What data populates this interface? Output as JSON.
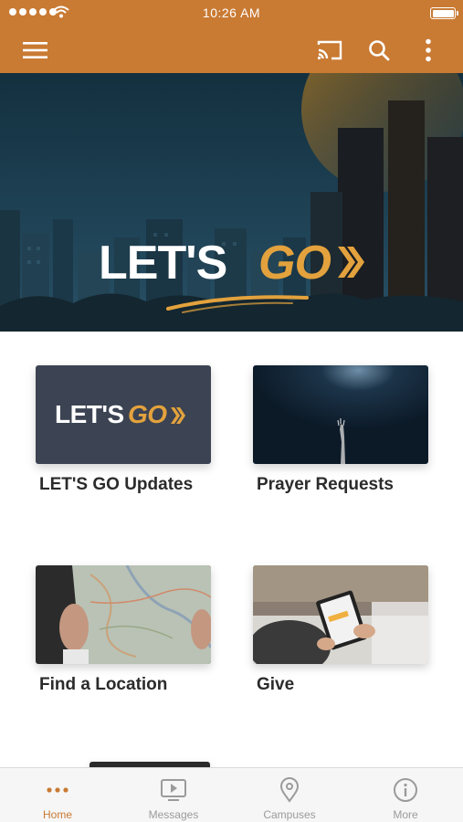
{
  "status_bar": {
    "time": "10:26 AM"
  },
  "app_bar": {
    "icons": [
      "menu-icon",
      "cast-icon",
      "search-icon",
      "more-vertical-icon"
    ]
  },
  "hero": {
    "logo_word_1": "LET'S",
    "logo_word_2": "GO"
  },
  "cards": [
    {
      "title": "LET'S GO Updates",
      "thumb_word_1": "LET'S",
      "thumb_word_2": "GO"
    },
    {
      "title": "Prayer Requests"
    },
    {
      "title": "Find a Location"
    },
    {
      "title": "Give"
    }
  ],
  "tabs": [
    {
      "label": "Home",
      "icon": "dots-icon",
      "active": true
    },
    {
      "label": "Messages",
      "icon": "video-icon",
      "active": false
    },
    {
      "label": "Campuses",
      "icon": "location-pin-icon",
      "active": false
    },
    {
      "label": "More",
      "icon": "info-icon",
      "active": false
    }
  ],
  "colors": {
    "brand": "#c97a33",
    "accent_gold": "#e3a23d",
    "tab_inactive": "#9b9b9b",
    "text": "#2b2b2b"
  }
}
